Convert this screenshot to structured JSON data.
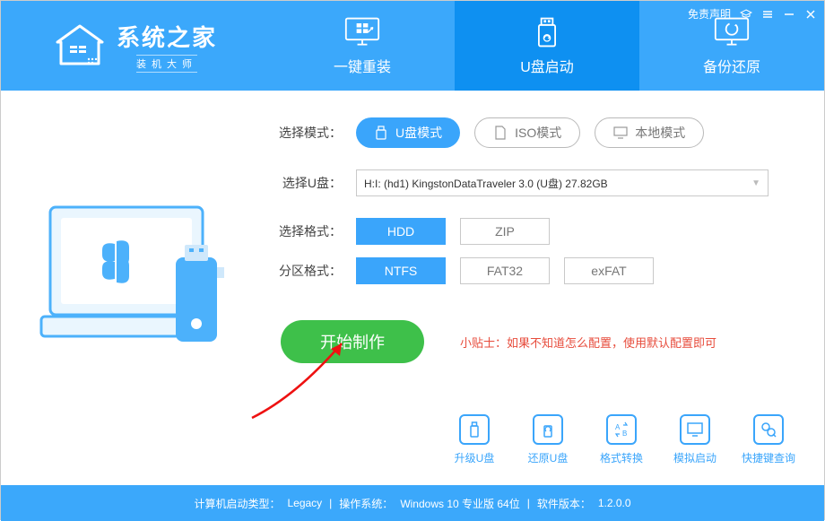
{
  "header": {
    "logo_title": "系统之家",
    "logo_sub": "装机大师",
    "disclaimer": "免责声明",
    "tabs": [
      {
        "label": "一键重装"
      },
      {
        "label": "U盘启动"
      },
      {
        "label": "备份还原"
      }
    ]
  },
  "panel": {
    "mode_label": "选择模式：",
    "modes": [
      {
        "label": "U盘模式"
      },
      {
        "label": "ISO模式"
      },
      {
        "label": "本地模式"
      }
    ],
    "usb_label": "选择U盘：",
    "usb_selected": "H:I: (hd1) KingstonDataTraveler 3.0 (U盘) 27.82GB",
    "format_label": "选择格式：",
    "formats": [
      {
        "label": "HDD"
      },
      {
        "label": "ZIP"
      }
    ],
    "partition_label": "分区格式：",
    "partitions": [
      {
        "label": "NTFS"
      },
      {
        "label": "FAT32"
      },
      {
        "label": "exFAT"
      }
    ],
    "start_label": "开始制作",
    "tip_prefix": "小贴士：",
    "tip_text": "如果不知道怎么配置，使用默认配置即可"
  },
  "quick_actions": [
    {
      "label": "升级U盘"
    },
    {
      "label": "还原U盘"
    },
    {
      "label": "格式转换"
    },
    {
      "label": "模拟启动"
    },
    {
      "label": "快捷键查询"
    }
  ],
  "footer": {
    "boot_type_label": "计算机启动类型：",
    "boot_type": "Legacy",
    "os_label": "操作系统：",
    "os": "Windows 10 专业版 64位",
    "ver_label": "软件版本：",
    "ver": "1.2.0.0"
  }
}
